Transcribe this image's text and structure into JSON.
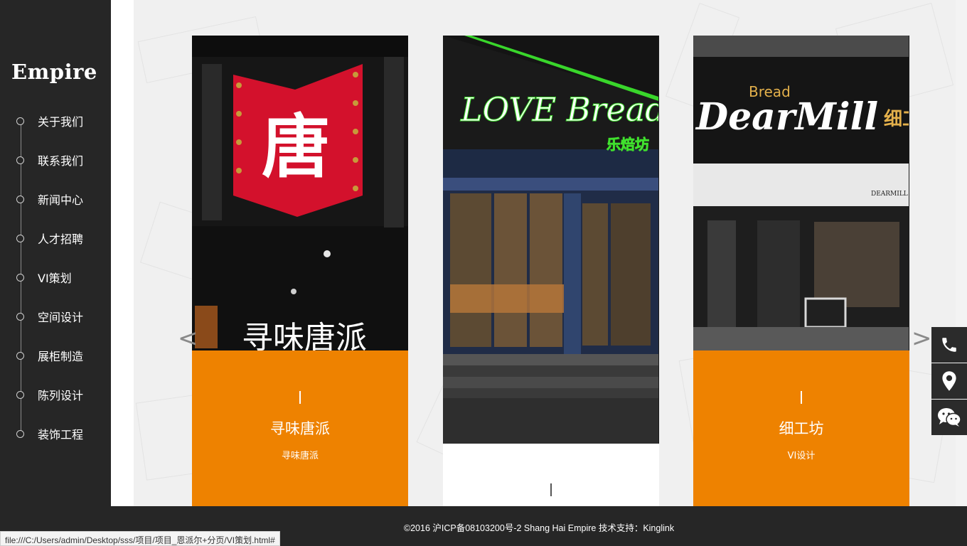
{
  "logo": "Empire",
  "nav": [
    {
      "label": "关于我们"
    },
    {
      "label": "联系我们"
    },
    {
      "label": "新闻中心"
    },
    {
      "label": "人才招聘"
    },
    {
      "label": "VI策划"
    },
    {
      "label": "空间设计"
    },
    {
      "label": "展柜制造"
    },
    {
      "label": "陈列设计"
    },
    {
      "label": "装饰工程"
    }
  ],
  "cards": [
    {
      "title": "寻味唐派",
      "subtitle": "寻味唐派",
      "sign_text": "寻味唐派",
      "logo_char": "唐"
    },
    {
      "title": "",
      "subtitle": "",
      "sign_text": "LOVE Breads",
      "sign_cn": "乐焙坊"
    },
    {
      "title": "细工坊",
      "subtitle": "VI设计",
      "sign_text": "DearMill",
      "sign_small": "Bread",
      "sign_right": "DEARMILL",
      "sign_cn": "细工"
    }
  ],
  "arrows": {
    "prev": "<",
    "next": ">"
  },
  "floats": [
    {
      "icon": "phone-icon"
    },
    {
      "icon": "location-pin-icon"
    },
    {
      "icon": "wechat-icon"
    }
  ],
  "footer": "©2016  沪ICP备08103200号-2 Shang  Hai  Empire  技术支持：Kinglink",
  "status_url": "file:///C:/Users/admin/Desktop/sss/项目/项目_恩派尔+分页/VI策划.html#",
  "colors": {
    "sidebar": "#262626",
    "accent": "#ee8200",
    "footer": "#262626"
  }
}
